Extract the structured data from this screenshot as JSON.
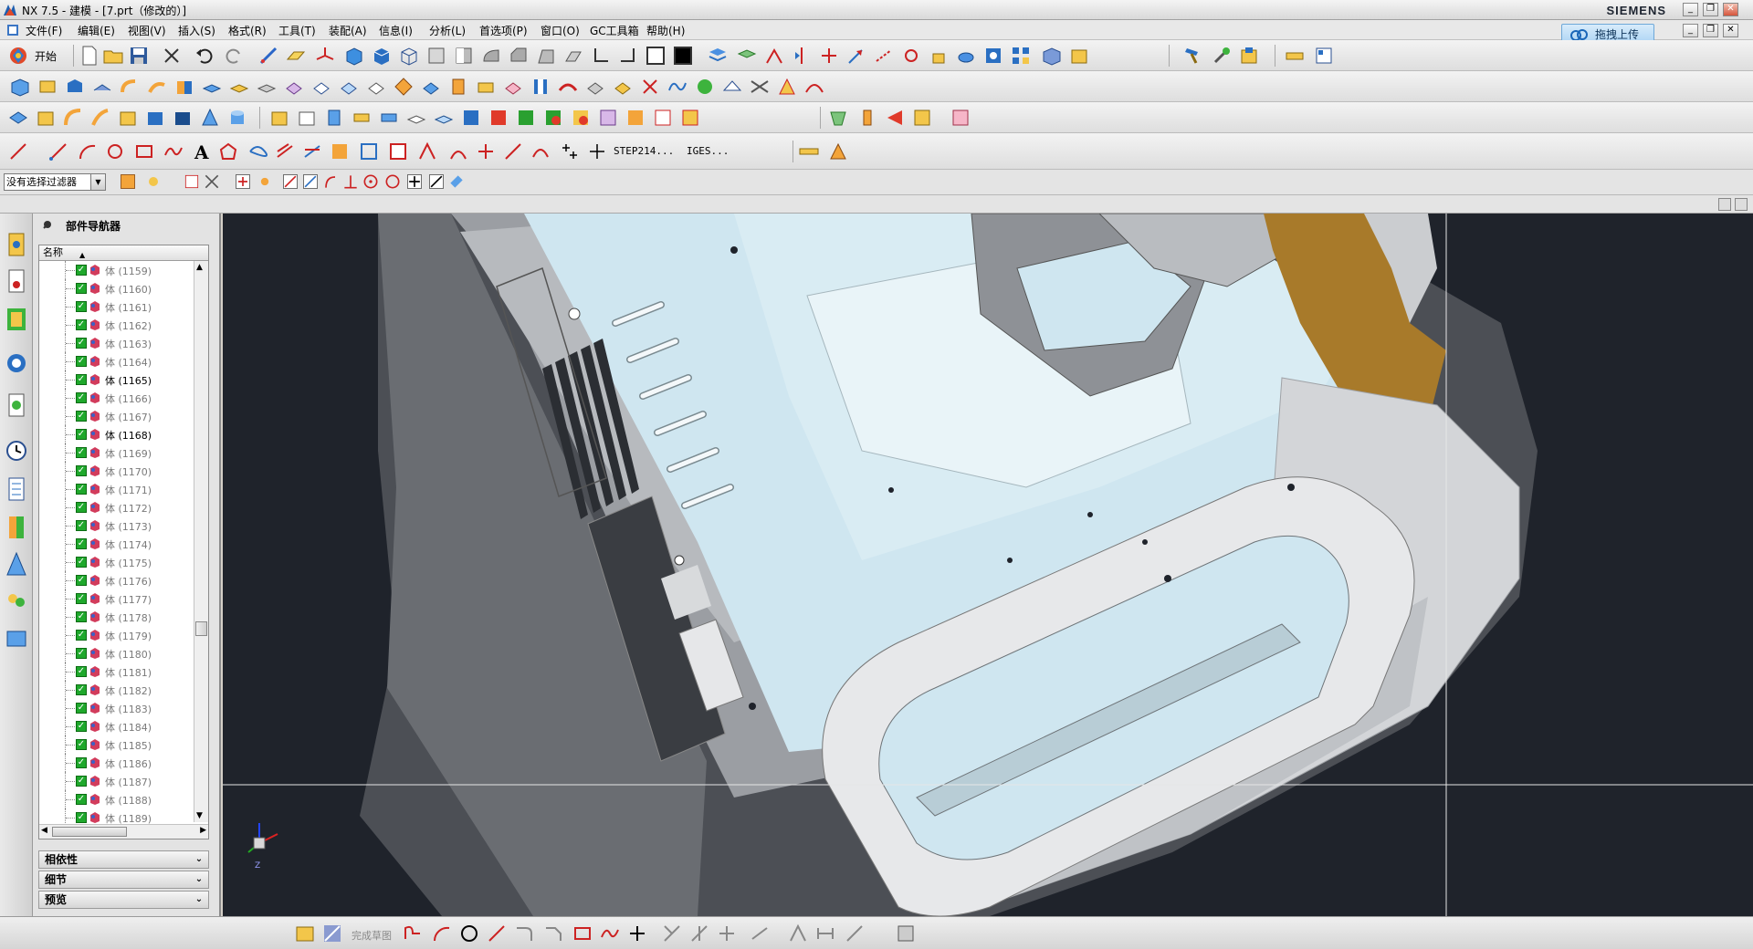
{
  "window": {
    "title": "NX 7.5 - 建模 - [7.prt（修改的）]",
    "brand": "SIEMENS",
    "controls": [
      "_",
      "❐",
      "✕"
    ]
  },
  "menubar": {
    "items": [
      "文件(F)",
      "编辑(E)",
      "视图(V)",
      "插入(S)",
      "格式(R)",
      "工具(T)",
      "装配(A)",
      "信息(I)",
      "分析(L)",
      "首选项(P)",
      "窗口(O)",
      "GC工具箱",
      "帮助(H)"
    ],
    "upload_button": "拖拽上传"
  },
  "toolbar1": {
    "start_label": "开始"
  },
  "toolbar4": {
    "step_label": "STEP214...",
    "iges_label": "IGES..."
  },
  "filterbar": {
    "selection_filter": "没有选择过滤器"
  },
  "navigator": {
    "title": "部件导航器",
    "column_name": "名称",
    "rows": [
      {
        "label": "体 (1159)",
        "active": false
      },
      {
        "label": "体 (1160)",
        "active": false
      },
      {
        "label": "体 (1161)",
        "active": false
      },
      {
        "label": "体 (1162)",
        "active": false
      },
      {
        "label": "体 (1163)",
        "active": false
      },
      {
        "label": "体 (1164)",
        "active": false
      },
      {
        "label": "体 (1165)",
        "active": true
      },
      {
        "label": "体 (1166)",
        "active": false
      },
      {
        "label": "体 (1167)",
        "active": false
      },
      {
        "label": "体 (1168)",
        "active": true
      },
      {
        "label": "体 (1169)",
        "active": false
      },
      {
        "label": "体 (1170)",
        "active": false
      },
      {
        "label": "体 (1171)",
        "active": false
      },
      {
        "label": "体 (1172)",
        "active": false
      },
      {
        "label": "体 (1173)",
        "active": false
      },
      {
        "label": "体 (1174)",
        "active": false
      },
      {
        "label": "体 (1175)",
        "active": false
      },
      {
        "label": "体 (1176)",
        "active": false
      },
      {
        "label": "体 (1177)",
        "active": false
      },
      {
        "label": "体 (1178)",
        "active": false
      },
      {
        "label": "体 (1179)",
        "active": false
      },
      {
        "label": "体 (1180)",
        "active": false
      },
      {
        "label": "体 (1181)",
        "active": false
      },
      {
        "label": "体 (1182)",
        "active": false
      },
      {
        "label": "体 (1183)",
        "active": false
      },
      {
        "label": "体 (1184)",
        "active": false
      },
      {
        "label": "体 (1185)",
        "active": false
      },
      {
        "label": "体 (1186)",
        "active": false
      },
      {
        "label": "体 (1187)",
        "active": false
      },
      {
        "label": "体 (1188)",
        "active": false
      },
      {
        "label": "体 (1189)",
        "active": false
      }
    ],
    "panels": [
      "相依性",
      "细节",
      "预览"
    ]
  },
  "bottombar": {
    "finish_sketch": "完成草图"
  },
  "triad": {
    "z_label": "Z"
  },
  "colors": {
    "viewport_bg": "#1f232b",
    "part_light": "#cfe6f0",
    "part_grey": "#d7d7d7",
    "part_orange": "#a87a2a",
    "checkbox": "#1fa82c"
  }
}
